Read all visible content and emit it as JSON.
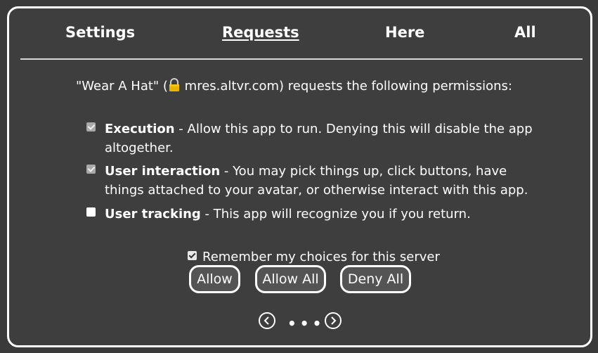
{
  "tabs": {
    "settings": "Settings",
    "requests": "Requests",
    "here": "Here",
    "all": "All"
  },
  "request": {
    "app_name_quoted": "\"Wear A Hat\" (",
    "host": " mres.altvr.com",
    "suffix": ") requests the following permissions:"
  },
  "permissions": [
    {
      "name": "Execution",
      "description": " - Allow this app to run. Denying this will disable the app altogether.",
      "checked": true,
      "disabled": true
    },
    {
      "name": "User interaction",
      "description": " - You may pick things up, click buttons, have things attached to your avatar, or otherwise interact with this app.",
      "checked": true,
      "disabled": true
    },
    {
      "name": "User tracking",
      "description": " - This app will recognize you if you return.",
      "checked": false,
      "disabled": false
    }
  ],
  "remember": {
    "label": "Remember my choices for this server",
    "checked": true
  },
  "buttons": {
    "allow": "Allow",
    "allow_all": "Allow All",
    "deny_all": "Deny All"
  },
  "pager": {
    "dots": "•••"
  },
  "colors": {
    "background": "#3e3e3e",
    "border": "#ffffff",
    "button_bg": "#545454",
    "lock": "#e8b400"
  }
}
